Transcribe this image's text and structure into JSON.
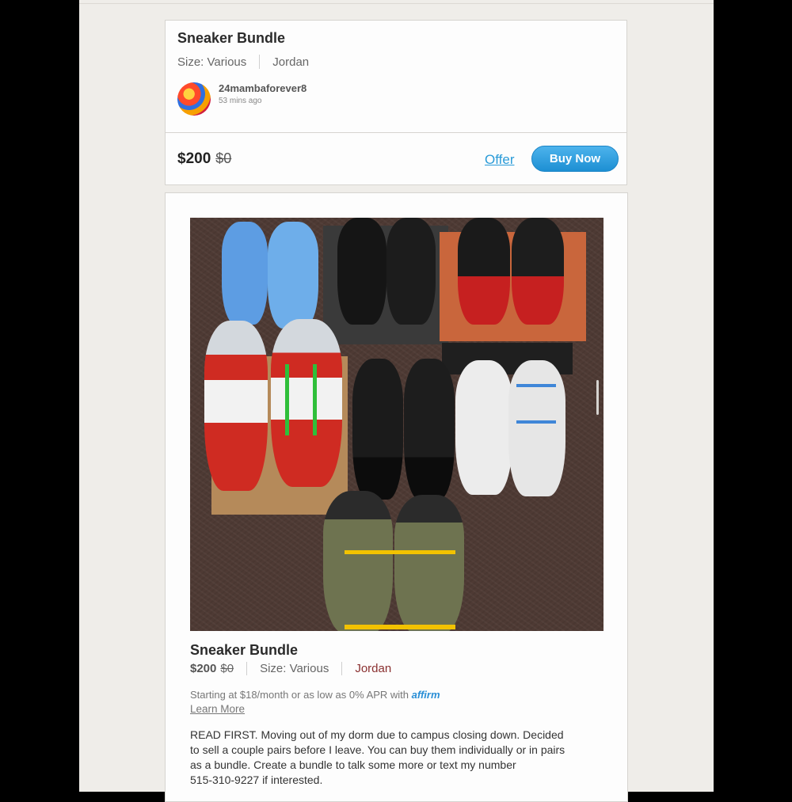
{
  "listing": {
    "title": "Sneaker Bundle",
    "size": "Size: Various",
    "brand": "Jordan",
    "seller": {
      "username": "24mambaforever8",
      "posted": "53 mins ago"
    },
    "price": "$200",
    "original_price": "$0",
    "offer_label": "Offer",
    "buy_label": "Buy Now"
  },
  "detail": {
    "title": "Sneaker Bundle",
    "price": "$200",
    "original_price": "$0",
    "size": "Size: Various",
    "brand": "Jordan",
    "financing": "Starting at $18/month or as low as 0% APR with",
    "financing_brand": "affirm",
    "learn_more": "Learn More",
    "description": "READ FIRST. Moving out of my dorm due to campus closing down. Decided\nto sell a couple pairs before I leave. You can buy them individually or in pairs\nas a bundle. Create a bundle to talk some more or text my number\n515-310-9227 if interested."
  },
  "colors": {
    "accent": "#2a9bd8",
    "buy_button": "#1d8fd3",
    "brand_text": "#8a3030",
    "background": "#efede9"
  }
}
